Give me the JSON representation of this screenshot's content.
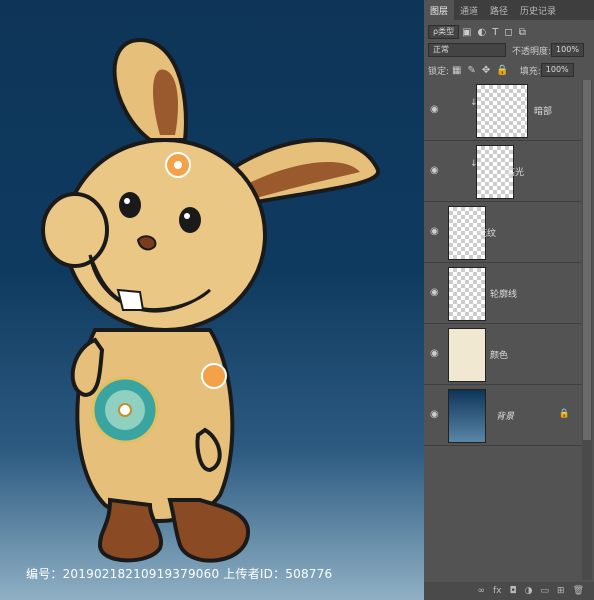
{
  "layers_panel": {
    "tabs": [
      "图层",
      "通道",
      "路径",
      "历史记录"
    ],
    "active_tab": "图层",
    "filter_type": "ρ类型",
    "blend_mode": "正常",
    "opacity_label": "不透明度:",
    "opacity_value": "100%",
    "lock_label": "锁定:",
    "fill_label": "填充:",
    "fill_value": "100%",
    "layers": [
      {
        "name": "暗部",
        "clipped": true,
        "thumb": "shadow"
      },
      {
        "name": "高光",
        "clipped": true,
        "thumb": "blank"
      },
      {
        "name": "花纹",
        "clipped": false,
        "thumb": "pattern"
      },
      {
        "name": "轮廓线",
        "clipped": false,
        "thumb": "outline"
      },
      {
        "name": "颜色",
        "clipped": false,
        "thumb": "color"
      },
      {
        "name": "背景",
        "clipped": false,
        "thumb": "background",
        "locked": true
      }
    ],
    "footer_icons": [
      "link-icon",
      "fx-icon",
      "mask-icon",
      "adjustment-icon",
      "group-icon",
      "new-layer-icon",
      "trash-icon"
    ]
  },
  "watermark": {
    "caption": "编号：20190218210919379060 上传者ID：508776"
  },
  "colors": {
    "canvas_top": "#0e3558",
    "canvas_bottom": "#8fb0c4",
    "panel_bg": "#535353"
  }
}
